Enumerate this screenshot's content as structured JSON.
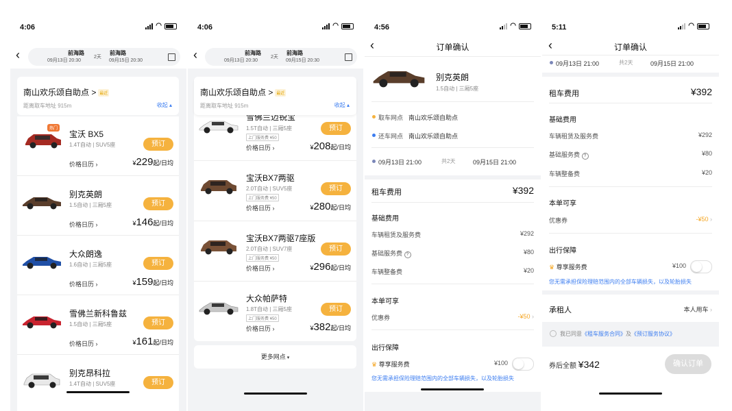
{
  "status_bar": {
    "s1_time": "4:06",
    "s2_time": "4:06",
    "s3_time": "4:56",
    "s4_time": "5:11"
  },
  "search": {
    "pickup_loc": "前海路",
    "pickup_date": "09月13日 20:30",
    "return_loc": "前海路",
    "return_date": "09月15日 20:30",
    "duration": "2天"
  },
  "store": {
    "name": "南山欢乐颂自助点",
    "arrow": ">",
    "near_tag": "最近",
    "distance": "距离取车地址 915m",
    "collapse": "收起"
  },
  "common": {
    "book": "预订",
    "price_calendar": "价格日历",
    "currency": "¥",
    "per_day": "起/日均",
    "service_fee": "上门服务费 ¥50",
    "hot": "热门"
  },
  "screen1": {
    "cars": [
      {
        "name": "宝沃 BX5",
        "spec": "1.4T自动 | SUV5座",
        "price": "229"
      },
      {
        "name": "别克英朗",
        "spec": "1.5自动 | 三厢5座",
        "price": "146"
      },
      {
        "name": "大众朗逸",
        "spec": "1.6自动 | 三厢5座",
        "price": "159"
      },
      {
        "name": "雪佛兰新科鲁兹",
        "spec": "1.5自动 | 三厢5座",
        "price": "161"
      },
      {
        "name": "别克昂科拉",
        "spec": "1.4T自动 | SUV5座"
      }
    ]
  },
  "screen2": {
    "cars": [
      {
        "name": "雪佛兰迈锐宝",
        "spec": "1.5T自动 | 三厢5座",
        "price": "208"
      },
      {
        "name": "宝沃BX7两驱",
        "spec": "2.0T自动 | SUV5座",
        "price": "280"
      },
      {
        "name": "宝沃BX7两驱7座版",
        "spec": "2.0T自动 | SUV7座",
        "price": "296"
      },
      {
        "name": "大众帕萨特",
        "spec": "1.8T自动 | 三厢5座",
        "price": "382"
      }
    ],
    "more": "更多网点"
  },
  "order": {
    "title": "订单确认",
    "car_name": "别克英朗",
    "car_spec": "1.5自动 | 三厢5座",
    "pickup_label": "取车网点",
    "pickup_value": "南山欢乐颂自助点",
    "return_label": "还车网点",
    "return_value": "南山欢乐颂自助点",
    "start": "09月13日 21:00",
    "mid": "共2天",
    "end": "09月15日 21:00",
    "rent_label": "租车费用",
    "rent_value": "¥392",
    "basic_title": "基础费用",
    "fee1_label": "车辆租赁及服务费",
    "fee1_value": "¥292",
    "fee2_label": "基础服务费",
    "fee2_value": "¥80",
    "fee3_label": "车辆整备费",
    "fee3_value": "¥20",
    "discount_title": "本单可享",
    "coupon_label": "优惠券",
    "coupon_value": "-¥50",
    "protect_title": "出行保障",
    "vip_label": "尊享服务费",
    "vip_value": "¥100",
    "vip_note": "您无需承担保险理赔范围内的全部车辆损失，以及轮胎损失",
    "renter_label": "承租人",
    "renter_value": "本人用车",
    "agree_prefix": "我已同意",
    "contract1": "《租车服务合同》",
    "agree_mid": "及",
    "contract2": "《预订服务协议》",
    "total_label": "券后全额",
    "total_value": "¥342",
    "confirm": "确认订单"
  },
  "colors": {
    "accent": "#f5b23e",
    "link": "#3c7df0",
    "coupon": "#f5a623",
    "background": "#f2f3f5"
  }
}
